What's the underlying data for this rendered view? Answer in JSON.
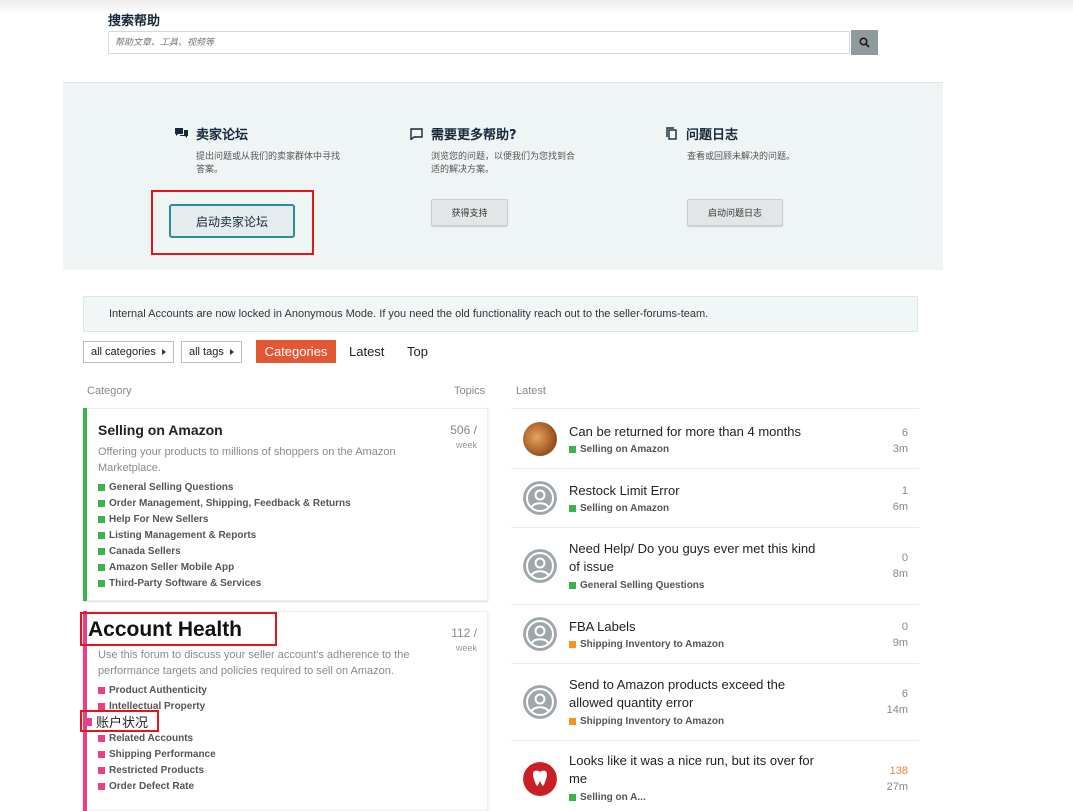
{
  "search": {
    "title": "搜索帮助",
    "placeholder": "帮助文章、工具、视频等"
  },
  "help": {
    "forum": {
      "title": "卖家论坛",
      "desc": "提出问题或从我们的卖家群体中寻找答案。",
      "button": "启动卖家论坛"
    },
    "more": {
      "title": "需要更多帮助?",
      "desc": "浏览您的问题，以便我们为您找到合适的解决方案。",
      "button": "获得支持"
    },
    "log": {
      "title": "问题日志",
      "desc": "查看或回顾未解决的问题。",
      "button": "启动问题日志"
    }
  },
  "notice": "Internal Accounts are now locked in Anonymous Mode. If you need the old functionality reach out to the seller-forums-team.",
  "nav": {
    "all_categories": "all categories",
    "all_tags": "all tags",
    "categories": "Categories",
    "latest": "Latest",
    "top": "Top"
  },
  "columns": {
    "category": "Category",
    "topics": "Topics",
    "latest": "Latest"
  },
  "categories": [
    {
      "name": "Selling on Amazon",
      "desc": "Offering your products to millions of shoppers on the Amazon Marketplace.",
      "count": "506 /",
      "period": "week",
      "color": "#3ab54a",
      "subs": [
        "General Selling Questions",
        "Order Management, Shipping, Feedback & Returns",
        "Help For New Sellers",
        "Listing Management & Reports",
        "Canada Sellers",
        "Amazon Seller Mobile App",
        "Third-Party Software & Services"
      ]
    },
    {
      "name": "Account Health",
      "desc": "Use this forum to discuss your seller account's adherence to the performance targets and policies required to sell on Amazon.",
      "count": "112 /",
      "period": "week",
      "color": "#e83e8c",
      "subs": [
        "Product Authenticity",
        "Intellectual Property",
        "",
        "Related Accounts",
        "Shipping Performance",
        "Restricted Products",
        "Order Defect Rate"
      ],
      "overlay_label": "账户状况"
    }
  ],
  "latest": [
    {
      "title": "Can be returned for more than 4 months",
      "category": "Selling on Amazon",
      "cat_color": "#3ab54a",
      "replies": "6",
      "age": "3m",
      "avatar": "photo"
    },
    {
      "title": "Restock Limit Error",
      "category": "Selling on Amazon",
      "cat_color": "#3ab54a",
      "replies": "1",
      "age": "6m",
      "avatar": "default"
    },
    {
      "title": "Need Help/ Do you guys ever met this kind of issue",
      "category": "General Selling Questions",
      "cat_color": "#3ab54a",
      "replies": "0",
      "age": "8m",
      "avatar": "default"
    },
    {
      "title": "FBA Labels",
      "category": "Shipping Inventory to Amazon",
      "cat_color": "#f7941d",
      "replies": "0",
      "age": "9m",
      "avatar": "default"
    },
    {
      "title": "Send to Amazon products exceed the allowed quantity error",
      "category": "Shipping Inventory to Amazon",
      "cat_color": "#f7941d",
      "replies": "6",
      "age": "14m",
      "avatar": "default"
    },
    {
      "title": "Looks like it was a nice run, but its over for me",
      "category": "Selling on A...",
      "cat_color": "#3ab54a",
      "replies": "138",
      "age": "27m",
      "avatar": "tooth",
      "hot": true
    }
  ]
}
